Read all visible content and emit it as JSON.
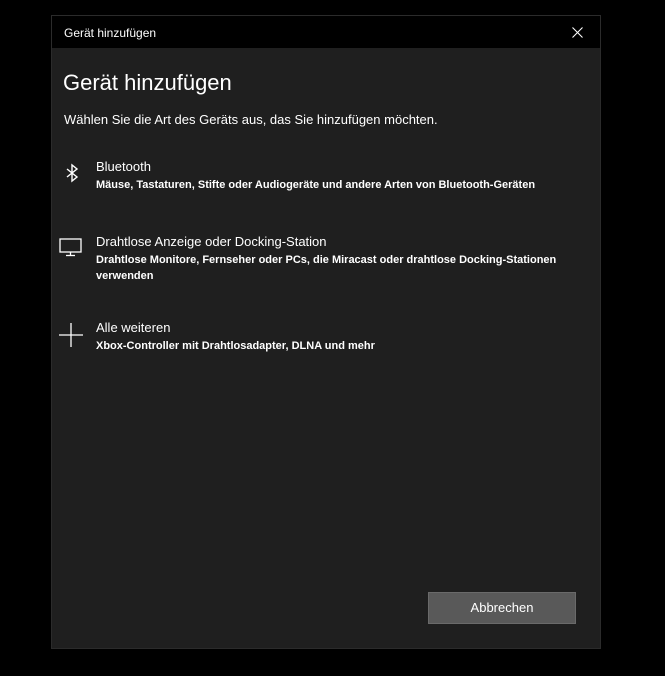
{
  "window": {
    "title": "Gerät hinzufügen"
  },
  "main": {
    "heading": "Gerät hinzufügen",
    "subtitle": "Wählen Sie die Art des Geräts aus, das Sie hinzufügen möchten."
  },
  "options": [
    {
      "icon": "bluetooth-icon",
      "title": "Bluetooth",
      "description": "Mäuse, Tastaturen, Stifte oder Audiogeräte und andere Arten von Bluetooth-Geräten"
    },
    {
      "icon": "monitor-icon",
      "title": "Drahtlose Anzeige oder Docking-Station",
      "description": "Drahtlose Monitore, Fernseher oder PCs, die Miracast oder drahtlose Docking-Stationen verwenden"
    },
    {
      "icon": "plus-icon",
      "title": "Alle weiteren",
      "description": "Xbox-Controller mit Drahtlosadapter, DLNA und mehr"
    }
  ],
  "footer": {
    "cancel_label": "Abbrechen"
  },
  "colors": {
    "window_background": "#1f1f1f",
    "titlebar_background": "#000000",
    "button_background": "#595959",
    "text": "#ffffff"
  }
}
